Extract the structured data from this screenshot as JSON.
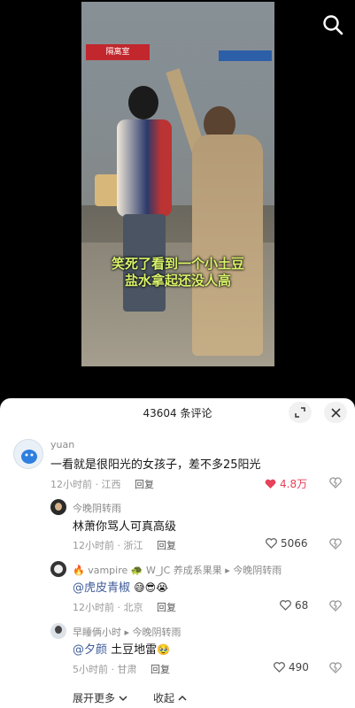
{
  "video": {
    "sign_text": "隔离室",
    "subtitle_line1": "笑死了看到一个小土豆",
    "subtitle_line2": "盐水拿起还没人高"
  },
  "comments_header": {
    "count_text": "43604 条评论"
  },
  "comments": [
    {
      "username": "yuan",
      "text": "一看就是很阳光的女孩子，差不多25阳光",
      "time": "12小时前 · 江西",
      "reply_label": "回复",
      "likes": "4.8万"
    }
  ],
  "replies": [
    {
      "username": "今晚阴转雨",
      "text": "林萧你骂人可真高级",
      "time": "12小时前 · 浙江",
      "reply_label": "回复",
      "likes": "5066"
    },
    {
      "username": "vampire",
      "username_mid": "W_JC 养成系果果",
      "reply_to": "今晚阴转雨",
      "mention": "@虎皮青椒",
      "emojis": "😅😎😭",
      "time": "12小时前 · 北京",
      "reply_label": "回复",
      "likes": "68"
    },
    {
      "username": "早睡俩小时",
      "reply_to": "今晚阴转雨",
      "mention": "@夕颜",
      "text": "土豆地雷",
      "emojis": "🥹",
      "time": "5小时前 · 甘肃",
      "reply_label": "回复",
      "likes": "490"
    }
  ],
  "footer": {
    "expand_more": "展开更多",
    "collapse": "收起"
  },
  "colors": {
    "like_active": "#e8415a",
    "mention": "#3f5c9a",
    "subtitle": "#d8f26a"
  }
}
